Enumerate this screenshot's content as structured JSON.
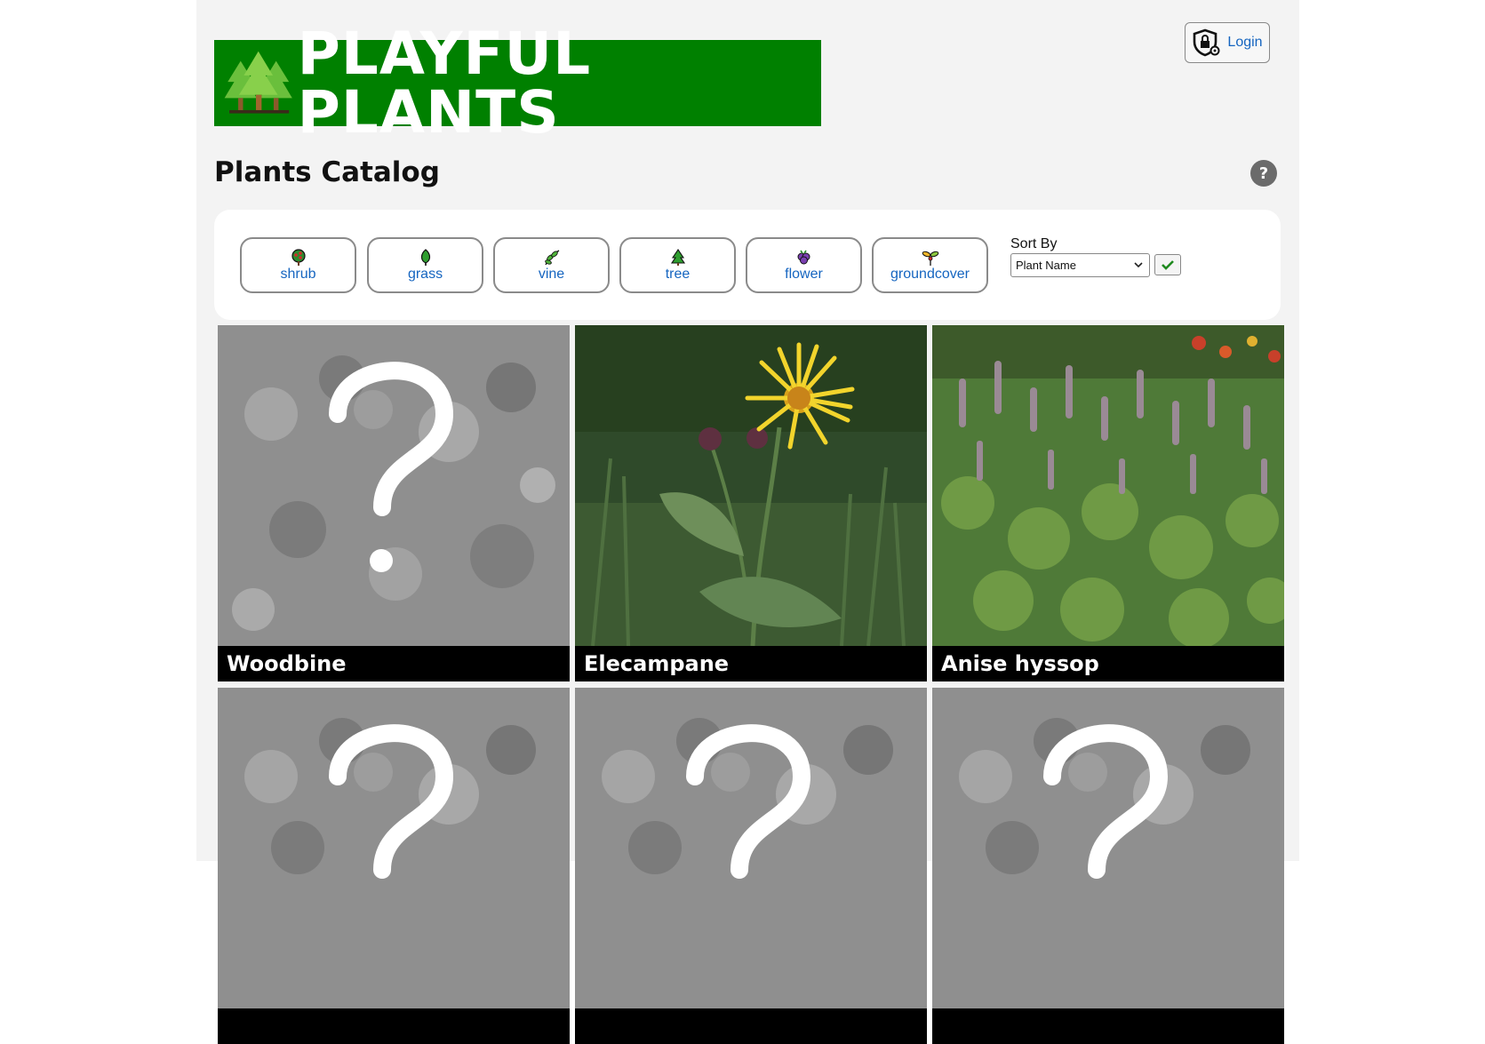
{
  "header": {
    "logo_text": "PLAYFUL PLANTS",
    "logo_icon": "trees-icon",
    "brand_color": "#008000",
    "login_label": "Login",
    "login_icon": "shield-lock-icon"
  },
  "page": {
    "title": "Plants Catalog",
    "help_label": "?"
  },
  "filters": {
    "types": [
      {
        "label": "shrub",
        "icon": "shrub-icon"
      },
      {
        "label": "grass",
        "icon": "grass-icon"
      },
      {
        "label": "vine",
        "icon": "vine-icon"
      },
      {
        "label": "tree",
        "icon": "tree-icon"
      },
      {
        "label": "flower",
        "icon": "flower-icon"
      },
      {
        "label": "groundcover",
        "icon": "groundcover-icon"
      }
    ],
    "sort": {
      "label": "Sort By",
      "selected": "Plant Name"
    }
  },
  "catalog": {
    "plants": [
      {
        "name": "Woodbine",
        "image": "placeholder"
      },
      {
        "name": "Elecampane",
        "image": "yellow-flower-photo"
      },
      {
        "name": "Anise hyssop",
        "image": "purple-spikes-photo"
      },
      {
        "name": "",
        "image": "placeholder"
      },
      {
        "name": "",
        "image": "placeholder"
      },
      {
        "name": "",
        "image": "placeholder"
      }
    ]
  }
}
